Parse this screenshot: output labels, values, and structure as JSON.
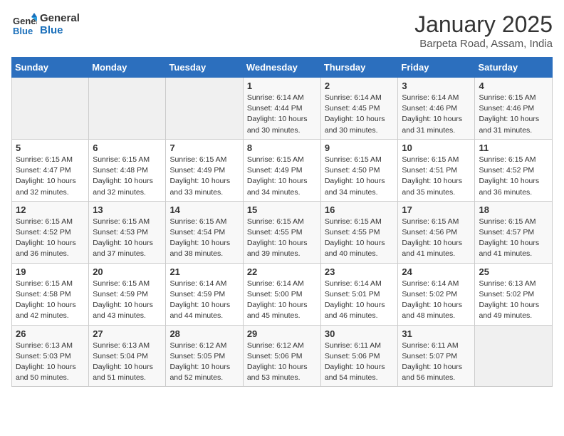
{
  "logo": {
    "line1": "General",
    "line2": "Blue"
  },
  "title": "January 2025",
  "location": "Barpeta Road, Assam, India",
  "weekdays": [
    "Sunday",
    "Monday",
    "Tuesday",
    "Wednesday",
    "Thursday",
    "Friday",
    "Saturday"
  ],
  "weeks": [
    [
      {
        "day": "",
        "content": ""
      },
      {
        "day": "",
        "content": ""
      },
      {
        "day": "",
        "content": ""
      },
      {
        "day": "1",
        "content": "Sunrise: 6:14 AM\nSunset: 4:44 PM\nDaylight: 10 hours\nand 30 minutes."
      },
      {
        "day": "2",
        "content": "Sunrise: 6:14 AM\nSunset: 4:45 PM\nDaylight: 10 hours\nand 30 minutes."
      },
      {
        "day": "3",
        "content": "Sunrise: 6:14 AM\nSunset: 4:46 PM\nDaylight: 10 hours\nand 31 minutes."
      },
      {
        "day": "4",
        "content": "Sunrise: 6:15 AM\nSunset: 4:46 PM\nDaylight: 10 hours\nand 31 minutes."
      }
    ],
    [
      {
        "day": "5",
        "content": "Sunrise: 6:15 AM\nSunset: 4:47 PM\nDaylight: 10 hours\nand 32 minutes."
      },
      {
        "day": "6",
        "content": "Sunrise: 6:15 AM\nSunset: 4:48 PM\nDaylight: 10 hours\nand 32 minutes."
      },
      {
        "day": "7",
        "content": "Sunrise: 6:15 AM\nSunset: 4:49 PM\nDaylight: 10 hours\nand 33 minutes."
      },
      {
        "day": "8",
        "content": "Sunrise: 6:15 AM\nSunset: 4:49 PM\nDaylight: 10 hours\nand 34 minutes."
      },
      {
        "day": "9",
        "content": "Sunrise: 6:15 AM\nSunset: 4:50 PM\nDaylight: 10 hours\nand 34 minutes."
      },
      {
        "day": "10",
        "content": "Sunrise: 6:15 AM\nSunset: 4:51 PM\nDaylight: 10 hours\nand 35 minutes."
      },
      {
        "day": "11",
        "content": "Sunrise: 6:15 AM\nSunset: 4:52 PM\nDaylight: 10 hours\nand 36 minutes."
      }
    ],
    [
      {
        "day": "12",
        "content": "Sunrise: 6:15 AM\nSunset: 4:52 PM\nDaylight: 10 hours\nand 36 minutes."
      },
      {
        "day": "13",
        "content": "Sunrise: 6:15 AM\nSunset: 4:53 PM\nDaylight: 10 hours\nand 37 minutes."
      },
      {
        "day": "14",
        "content": "Sunrise: 6:15 AM\nSunset: 4:54 PM\nDaylight: 10 hours\nand 38 minutes."
      },
      {
        "day": "15",
        "content": "Sunrise: 6:15 AM\nSunset: 4:55 PM\nDaylight: 10 hours\nand 39 minutes."
      },
      {
        "day": "16",
        "content": "Sunrise: 6:15 AM\nSunset: 4:55 PM\nDaylight: 10 hours\nand 40 minutes."
      },
      {
        "day": "17",
        "content": "Sunrise: 6:15 AM\nSunset: 4:56 PM\nDaylight: 10 hours\nand 41 minutes."
      },
      {
        "day": "18",
        "content": "Sunrise: 6:15 AM\nSunset: 4:57 PM\nDaylight: 10 hours\nand 41 minutes."
      }
    ],
    [
      {
        "day": "19",
        "content": "Sunrise: 6:15 AM\nSunset: 4:58 PM\nDaylight: 10 hours\nand 42 minutes."
      },
      {
        "day": "20",
        "content": "Sunrise: 6:15 AM\nSunset: 4:59 PM\nDaylight: 10 hours\nand 43 minutes."
      },
      {
        "day": "21",
        "content": "Sunrise: 6:14 AM\nSunset: 4:59 PM\nDaylight: 10 hours\nand 44 minutes."
      },
      {
        "day": "22",
        "content": "Sunrise: 6:14 AM\nSunset: 5:00 PM\nDaylight: 10 hours\nand 45 minutes."
      },
      {
        "day": "23",
        "content": "Sunrise: 6:14 AM\nSunset: 5:01 PM\nDaylight: 10 hours\nand 46 minutes."
      },
      {
        "day": "24",
        "content": "Sunrise: 6:14 AM\nSunset: 5:02 PM\nDaylight: 10 hours\nand 48 minutes."
      },
      {
        "day": "25",
        "content": "Sunrise: 6:13 AM\nSunset: 5:02 PM\nDaylight: 10 hours\nand 49 minutes."
      }
    ],
    [
      {
        "day": "26",
        "content": "Sunrise: 6:13 AM\nSunset: 5:03 PM\nDaylight: 10 hours\nand 50 minutes."
      },
      {
        "day": "27",
        "content": "Sunrise: 6:13 AM\nSunset: 5:04 PM\nDaylight: 10 hours\nand 51 minutes."
      },
      {
        "day": "28",
        "content": "Sunrise: 6:12 AM\nSunset: 5:05 PM\nDaylight: 10 hours\nand 52 minutes."
      },
      {
        "day": "29",
        "content": "Sunrise: 6:12 AM\nSunset: 5:06 PM\nDaylight: 10 hours\nand 53 minutes."
      },
      {
        "day": "30",
        "content": "Sunrise: 6:11 AM\nSunset: 5:06 PM\nDaylight: 10 hours\nand 54 minutes."
      },
      {
        "day": "31",
        "content": "Sunrise: 6:11 AM\nSunset: 5:07 PM\nDaylight: 10 hours\nand 56 minutes."
      },
      {
        "day": "",
        "content": ""
      }
    ]
  ]
}
